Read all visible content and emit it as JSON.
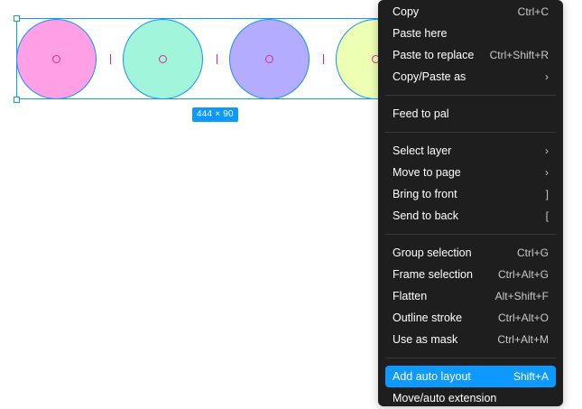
{
  "canvas": {
    "size_label": "444 × 90",
    "circle_colors": [
      "#ff9fe5",
      "#a0f5da",
      "#b3acff",
      "#edffb3"
    ]
  },
  "menu": {
    "groups": [
      [
        {
          "label": "Copy",
          "shortcut": "Ctrl+C"
        },
        {
          "label": "Paste here",
          "shortcut": ""
        },
        {
          "label": "Paste to replace",
          "shortcut": "Ctrl+Shift+R"
        },
        {
          "label": "Copy/Paste as",
          "shortcut": "›"
        }
      ],
      [
        {
          "label": "Feed to pal",
          "shortcut": ""
        }
      ],
      [
        {
          "label": "Select layer",
          "shortcut": "›"
        },
        {
          "label": "Move to page",
          "shortcut": "›"
        },
        {
          "label": "Bring to front",
          "shortcut": "]"
        },
        {
          "label": "Send to back",
          "shortcut": "["
        }
      ],
      [
        {
          "label": "Group selection",
          "shortcut": "Ctrl+G"
        },
        {
          "label": "Frame selection",
          "shortcut": "Ctrl+Alt+G"
        },
        {
          "label": "Flatten",
          "shortcut": "Alt+Shift+F"
        },
        {
          "label": "Outline stroke",
          "shortcut": "Ctrl+Alt+O"
        },
        {
          "label": "Use as mask",
          "shortcut": "Ctrl+Alt+M"
        }
      ],
      [
        {
          "label": "Add auto layout",
          "shortcut": "Shift+A",
          "highlighted": true
        },
        {
          "label": "Move/auto extension",
          "shortcut": ""
        }
      ]
    ]
  }
}
